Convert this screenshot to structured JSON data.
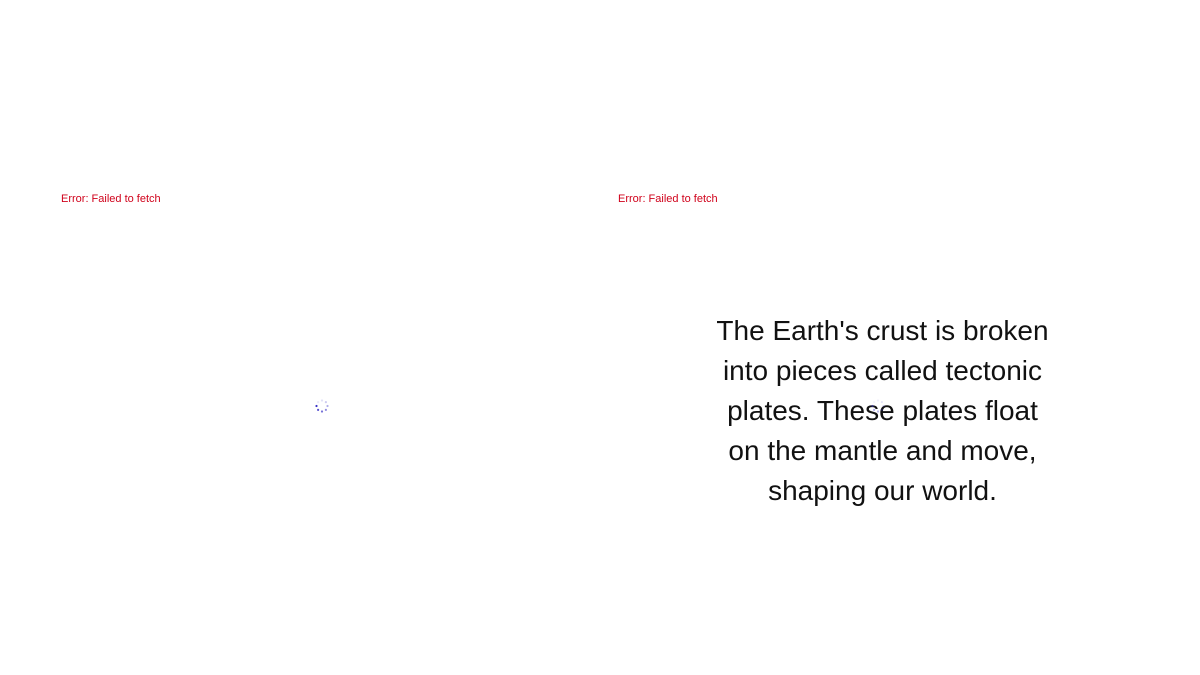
{
  "left_pane": {
    "error_message": "Error: Failed to fetch"
  },
  "right_pane": {
    "error_message": "Error: Failed to fetch",
    "caption_text": "The Earth's crust is broken into pieces called tectonic plates. These plates float on the mantle and move, shaping our world."
  },
  "icons": {
    "spinner": "loading-spinner-icon"
  },
  "colors": {
    "error": "#d0021b",
    "spinner": "#3a33c8",
    "text": "#111111",
    "background": "#ffffff"
  }
}
